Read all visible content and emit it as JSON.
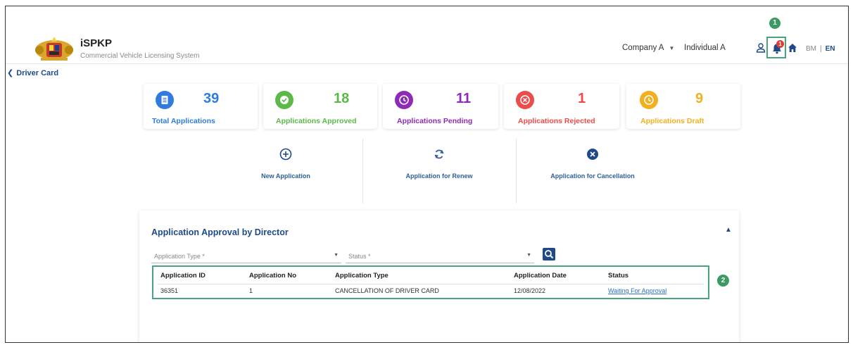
{
  "header": {
    "brand_title": "iSPKP",
    "brand_subtitle": "Commercial Vehicle Licensing System",
    "company": "Company A",
    "individual": "Individual A",
    "notification_count": "1",
    "lang_bm": "BM",
    "lang_sep": "|",
    "lang_en": "EN"
  },
  "markers": {
    "m1": "1",
    "m2": "2"
  },
  "breadcrumb": {
    "back_label": "Driver Card"
  },
  "stats": [
    {
      "value": "39",
      "label": "Total Applications",
      "color": "#2f7be0"
    },
    {
      "value": "18",
      "label": "Applications Approved",
      "color": "#5cb847"
    },
    {
      "value": "11",
      "label": "Applications Pending",
      "color": "#8e2ab5"
    },
    {
      "value": "1",
      "label": "Applications Rejected",
      "color": "#ee4b4b"
    },
    {
      "value": "9",
      "label": "Applications Draft",
      "color": "#f2b01e"
    }
  ],
  "actions": [
    {
      "label": "New Application",
      "icon": "plus-circle-icon"
    },
    {
      "label": "Application for Renew",
      "icon": "renew-icon"
    },
    {
      "label": "Application for Cancellation",
      "icon": "cancel-circle-icon"
    }
  ],
  "panel": {
    "title": "Application Approval by Director",
    "application_type_placeholder": "Application Type *",
    "status_placeholder": "Status *",
    "columns": [
      "Application ID",
      "Application No",
      "Application Type",
      "Application Date",
      "Status"
    ],
    "rows": [
      [
        "36351",
        "1",
        "CANCELLATION OF DRIVER CARD",
        "12/08/2022",
        "Waiting For Approval"
      ]
    ]
  },
  "colors": {
    "primary": "#1e4a8a",
    "highlight": "#4aa47b"
  }
}
